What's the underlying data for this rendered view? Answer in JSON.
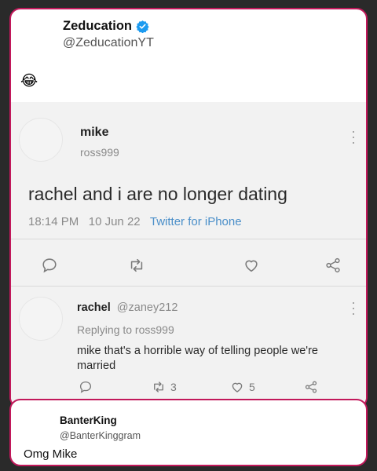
{
  "header": {
    "name": "Zeducation",
    "handle": "@ZeducationYT",
    "emoji": "😂"
  },
  "tweet": {
    "name": "mike",
    "handle": "ross999",
    "text": "rachel and i are no longer dating",
    "time": "18:14 PM",
    "date": "10 Jun 22",
    "source": "Twitter for iPhone"
  },
  "reply": {
    "name": "rachel",
    "handle": "@zaney212",
    "replying_to": "Replying to ross999",
    "text_line1": "mike that's a horrible way of telling people we're",
    "text_line2": "married",
    "retweets": "3",
    "likes": "5"
  },
  "comment": {
    "name": "BanterKing",
    "handle": "@BanterKinggram",
    "text": "Omg Mike"
  },
  "colors": {
    "accent_border": "#c2185b",
    "verified": "#1d9bf0",
    "source_link": "#4b8fc9"
  },
  "icons": [
    "verified-icon",
    "more-icon",
    "comment-icon",
    "retweet-icon",
    "heart-icon",
    "share-icon"
  ]
}
